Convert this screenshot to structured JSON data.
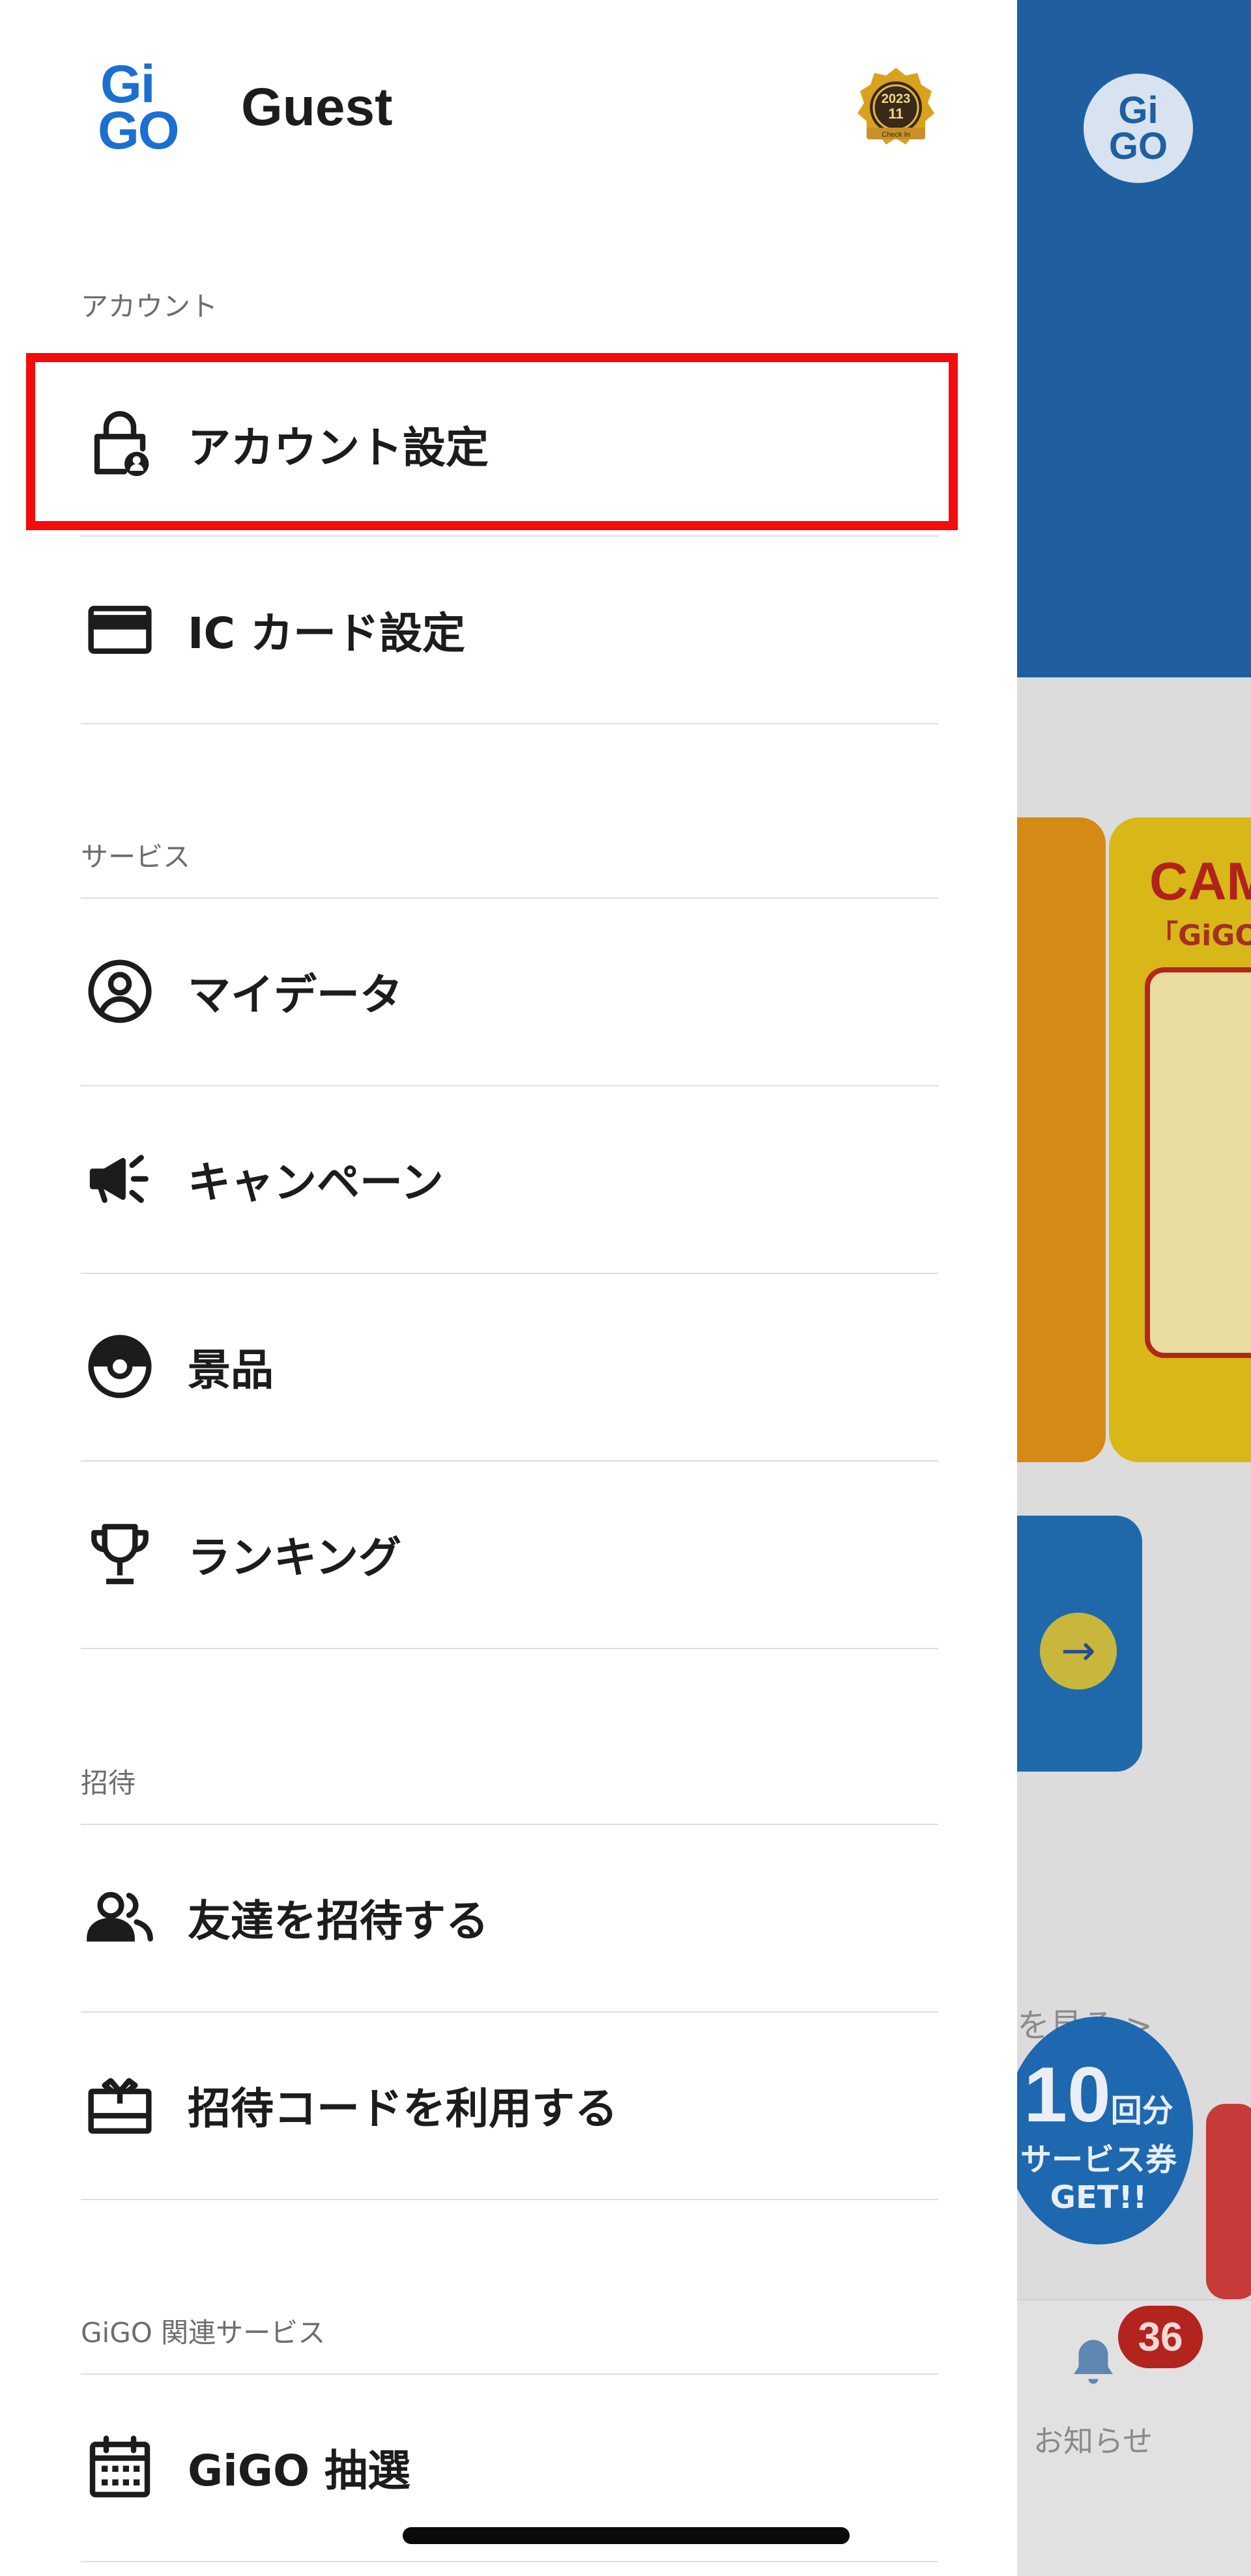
{
  "user": {
    "name": "Guest",
    "logo_text_top": "Gi",
    "logo_text_bottom": "GO",
    "badge_year": "2023",
    "badge_month": "11",
    "badge_caption": "Check In"
  },
  "sections": {
    "account": "アカウント",
    "service": "サービス",
    "invite": "招待",
    "related": "GiGO 関連サービス"
  },
  "menu": {
    "account_settings": "アカウント設定",
    "ic_card": "IC カード設定",
    "mydata": "マイデータ",
    "campaign": "キャンペーン",
    "prizes": "景品",
    "ranking": "ランキング",
    "invite_friends": "友達を招待する",
    "use_invite_code": "招待コードを利用する",
    "gigo_lottery": "GiGO 抽選"
  },
  "background": {
    "logo_top": "Gi",
    "logo_bottom": "GO",
    "campaign_title": "CAM",
    "campaign_sub": "「GiGO",
    "see_more": "を見る >",
    "promo_number": "10",
    "promo_unit": "回分",
    "promo_line1": "サービス券",
    "promo_line2": "GET!!",
    "notification_count": "36",
    "notification_label": "お知らせ"
  },
  "colors": {
    "brand_blue": "#1a6fd1",
    "highlight_red": "#f20c0c",
    "badge_red": "#b3241f"
  }
}
